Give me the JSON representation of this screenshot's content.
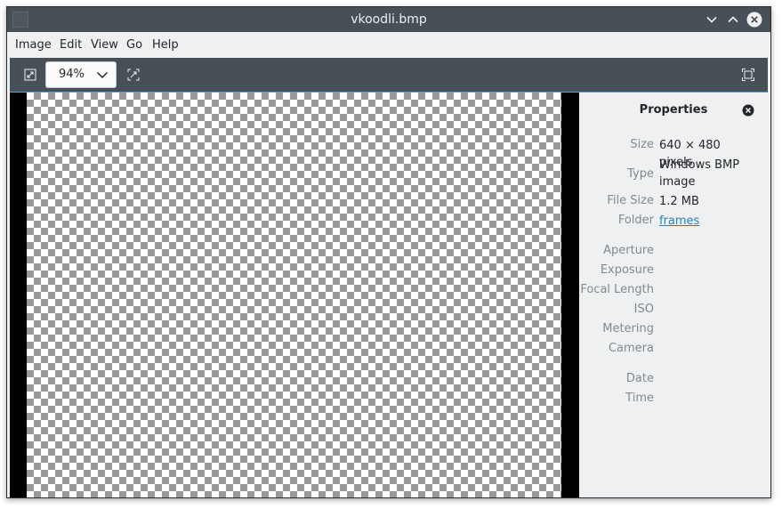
{
  "window": {
    "title": "vkoodli.bmp"
  },
  "titlebar_buttons": {
    "minimize_icon": "chevron-down-icon",
    "maximize_icon": "chevron-up-icon",
    "close_icon": "close-circle-icon"
  },
  "menu": {
    "items": [
      "Image",
      "Edit",
      "View",
      "Go",
      "Help"
    ]
  },
  "toolbar": {
    "zoom_value": "94%",
    "zoom_to_fit_icon": "zoom-fit-icon",
    "zoom_actual_icon": "zoom-original-icon",
    "fullscreen_icon": "fullscreen-icon"
  },
  "properties": {
    "title": "Properties",
    "rows": [
      {
        "label": "Size",
        "value": "640 × 480 pixels"
      },
      {
        "label": "Type",
        "value": "Windows BMP image"
      },
      {
        "label": "File Size",
        "value": "1.2 MB"
      },
      {
        "label": "Folder",
        "value": "frames"
      },
      {
        "label": "Aperture",
        "value": ""
      },
      {
        "label": "Exposure",
        "value": ""
      },
      {
        "label": "Focal Length",
        "value": ""
      },
      {
        "label": "ISO",
        "value": ""
      },
      {
        "label": "Metering",
        "value": ""
      },
      {
        "label": "Camera",
        "value": ""
      },
      {
        "label": "Date",
        "value": ""
      },
      {
        "label": "Time",
        "value": ""
      }
    ]
  },
  "colors": {
    "titlebar": "#475057",
    "toolbar": "#475057",
    "accent": "#3daee9",
    "window_bg": "#eff0f1",
    "link": "#2980b9"
  }
}
